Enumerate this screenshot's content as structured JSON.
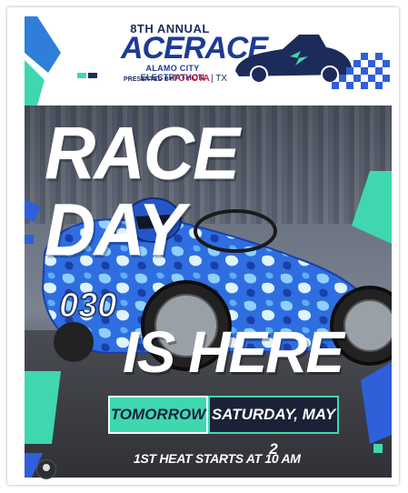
{
  "header": {
    "annual": "8TH ANNUAL",
    "title": "ACERACE",
    "subtitle": "ALAMO CITY ELECTRATHON",
    "presented_by": "PRESENTED BY:",
    "sponsor": "TOYOTA",
    "sponsor_region": "| TX"
  },
  "headline": {
    "line1": "RACE DAY",
    "line2": "IS HERE"
  },
  "date": {
    "tomorrow": "TOMORROW",
    "day": "SATURDAY, MAY 2"
  },
  "footer": {
    "heat": "1ST HEAT STARTS AT 10 AM"
  },
  "car": {
    "number": "030"
  },
  "colors": {
    "accent_teal": "#3fd7b0",
    "accent_blue": "#2f5fd9",
    "navy": "#1d3b94",
    "toyota_red": "#d8192b"
  },
  "icons": {
    "car_logo": "race-car-icon",
    "profile": "user-icon"
  }
}
